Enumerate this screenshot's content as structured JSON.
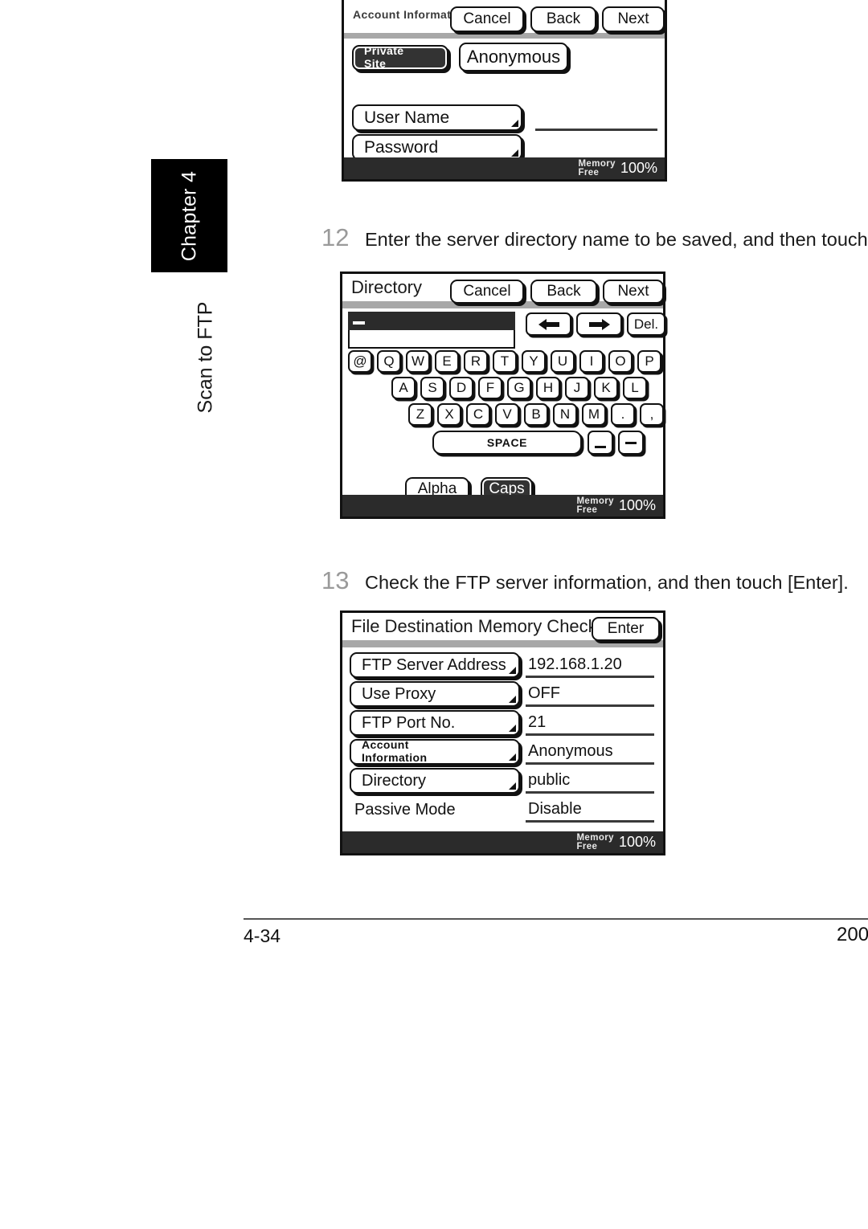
{
  "page": {
    "chapter_tab": "Chapter 4",
    "section_label": "Scan to FTP",
    "footer_page": "4-34",
    "footer_right": "200"
  },
  "steps": [
    {
      "number": "12",
      "text": "Enter the server directory name to be saved, and then touch"
    },
    {
      "number": "13",
      "text": "Check the FTP server information, and then touch [Enter]."
    }
  ],
  "panel_account": {
    "title_line1": "Account",
    "title_line2": "Information",
    "buttons": {
      "cancel": "Cancel",
      "back": "Back",
      "next": "Next"
    },
    "mode_buttons": [
      {
        "line1": "Private",
        "line2": "Site",
        "selected": true
      },
      {
        "label": "Anonymous",
        "selected": false
      }
    ],
    "fields": [
      {
        "label": "User Name",
        "value": ""
      },
      {
        "label": "Password",
        "value": ""
      }
    ],
    "status": {
      "memory": "Memory",
      "free": "Free",
      "percent": "100%"
    }
  },
  "panel_directory": {
    "title": "Directory",
    "buttons": {
      "cancel": "Cancel",
      "back": "Back",
      "next": "Next",
      "delete": "Del.",
      "space": "SPACE",
      "alpha": "Alpha",
      "caps": "Caps"
    },
    "input_value": "",
    "nav_icons": {
      "left": "arrow-left-icon",
      "right": "arrow-right-icon"
    },
    "keyboard": {
      "row1": [
        "@",
        "Q",
        "W",
        "E",
        "R",
        "T",
        "Y",
        "U",
        "I",
        "O",
        "P"
      ],
      "row2": [
        "A",
        "S",
        "D",
        "F",
        "G",
        "H",
        "J",
        "K",
        "L"
      ],
      "row3": [
        "Z",
        "X",
        "C",
        "V",
        "B",
        "N",
        "M",
        ".",
        ","
      ],
      "row4_special": [
        "_",
        "-"
      ]
    },
    "caps_selected": true,
    "status": {
      "memory": "Memory",
      "free": "Free",
      "percent": "100%"
    }
  },
  "panel_check": {
    "title": "File Destination Memory Check",
    "buttons": {
      "enter": "Enter"
    },
    "rows": [
      {
        "label": "FTP Server Address",
        "value": "192.168.1.20",
        "is_button": true
      },
      {
        "label": "Use Proxy",
        "value": "OFF",
        "is_button": true
      },
      {
        "label": "FTP Port No.",
        "value": "21",
        "is_button": true
      },
      {
        "label_line1": "Account",
        "label_line2": "Information",
        "value": "Anonymous",
        "is_button": true,
        "two_line": true
      },
      {
        "label": "Directory",
        "value": "public",
        "is_button": true
      },
      {
        "label": "Passive Mode",
        "value": "Disable",
        "is_button": false
      }
    ],
    "status": {
      "memory": "Memory",
      "free": "Free",
      "percent": "100%"
    }
  }
}
